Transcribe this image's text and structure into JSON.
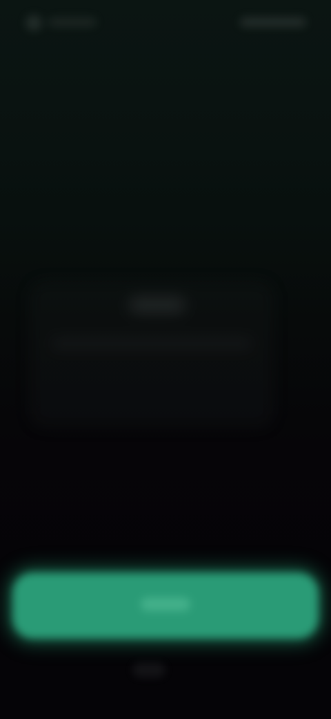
{
  "status_bar": {
    "left_text": "",
    "right_text": ""
  },
  "card": {
    "title": "",
    "body": ""
  },
  "primary_button": {
    "label": ""
  },
  "secondary_link": {
    "label": ""
  },
  "colors": {
    "background_top": "#0b1512",
    "background_bottom": "#050407",
    "accent": "#2a9b76"
  },
  "note_visibility": "blurred"
}
